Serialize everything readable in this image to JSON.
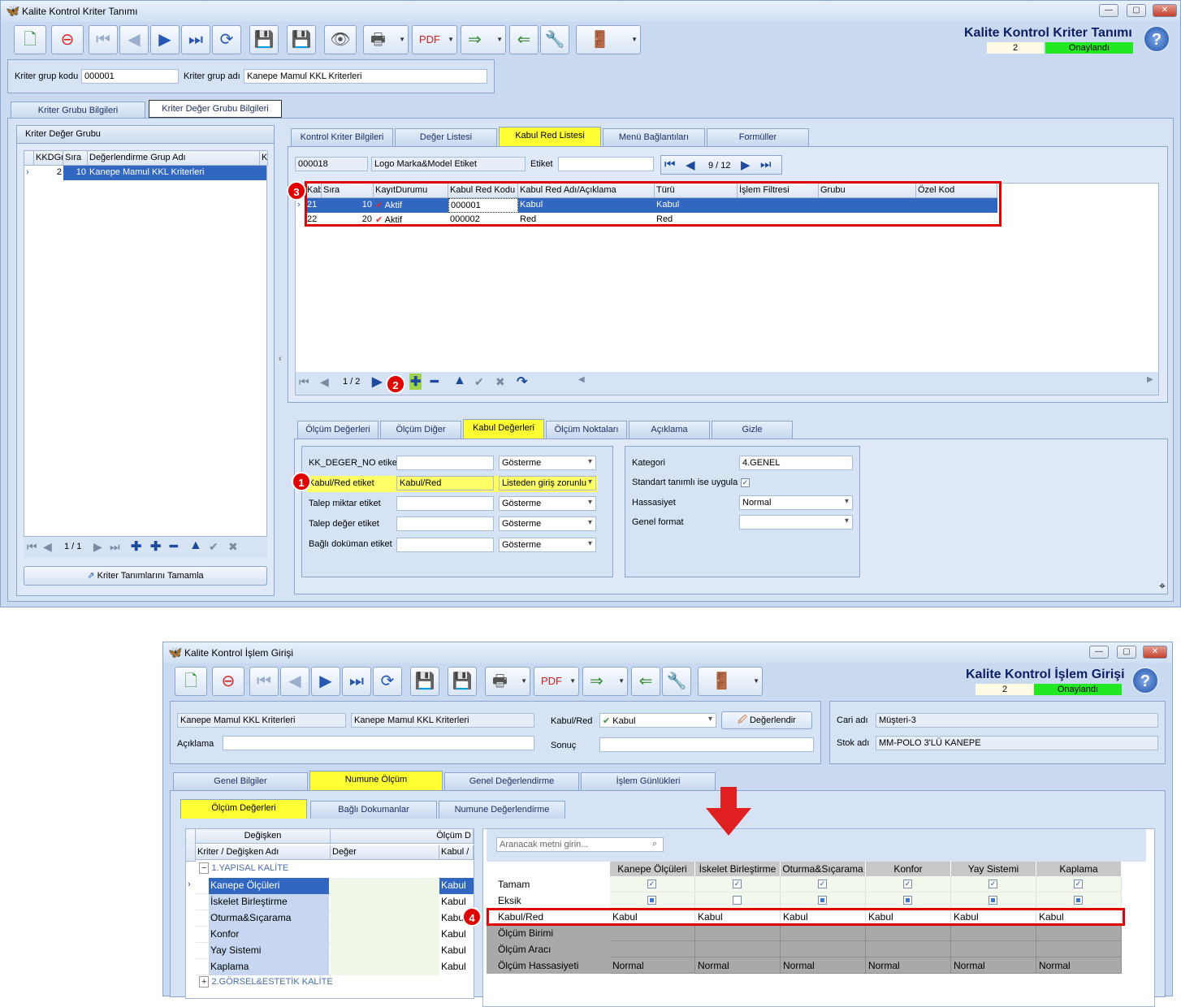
{
  "win1": {
    "title": "Kalite Kontrol Kriter Tanımı",
    "big_title": "Kalite Kontrol Kriter Tanımı",
    "status_num": "2",
    "status_text": "Onaylandı",
    "grp_kod_label": "Kriter grup kodu",
    "grp_kod": "000001",
    "grp_adi_label": "Kriter grup adı",
    "grp_adi": "Kanepe Mamul KKL Kriterleri",
    "tabs": [
      "Kriter Grubu Bilgileri",
      "Kriter Değer Grubu Bilgileri"
    ],
    "left_panel_title": "Kriter Değer Grubu",
    "left_grid_headers": [
      "KKDGr",
      "Sıra",
      "Değerlendirme Grup Adı",
      "K"
    ],
    "left_grid_row": {
      "kk": "2",
      "sira": "10",
      "ad": "Kanepe Mamul KKL Kriterleri"
    },
    "left_nav_pager": "1 / 1",
    "left_button": "Kriter Tanımlarını Tamamla",
    "right_tabs": [
      "Kontrol Kriter Bilgileri",
      "Değer Listesi",
      "Kabul Red Listesi",
      "Menü Bağlantıları",
      "Formüller"
    ],
    "code": "000018",
    "code_name": "Logo Marka&Model Etiket",
    "etiket_label": "Etiket",
    "etiket_value": "",
    "pager": "9 / 12",
    "grid_headers": [
      "Kab",
      "Sıra",
      "KayıtDurumu",
      "Kabul Red Kodu",
      "Kabul Red Adı/Açıklama",
      "Türü",
      "İşlem Filtresi",
      "Grubu",
      "Özel Kod"
    ],
    "grid_rows": [
      {
        "kab": "21",
        "sira": "10",
        "durum": "Aktif",
        "kod": "000001",
        "ad": "Kabul",
        "turu": "Kabul"
      },
      {
        "kab": "22",
        "sira": "20",
        "durum": "Aktif",
        "kod": "000002",
        "ad": "Red",
        "turu": "Red"
      }
    ],
    "grid_pager": "1 / 2",
    "bottom_tabs": [
      "Ölçüm Değerleri",
      "Ölçüm Diğer",
      "Kabul Değerleri",
      "Ölçüm Noktaları",
      "Açıklama",
      "Gizle"
    ],
    "form_rows": [
      {
        "label": "KK_DEGER_NO etiket",
        "value": "",
        "combo": "Gösterme"
      },
      {
        "label": "Kabul/Red etiket",
        "value": "Kabul/Red",
        "combo": "Listeden giriş zorunlu"
      },
      {
        "label": "Talep miktar etiket",
        "value": "",
        "combo": "Gösterme"
      },
      {
        "label": "Talep değer etiket",
        "value": "",
        "combo": "Gösterme"
      },
      {
        "label": "Bağlı doküman etiket",
        "value": "",
        "combo": "Gösterme"
      }
    ],
    "kategori_label": "Kategori",
    "kategori": "4.GENEL",
    "standart_label": "Standart tanımlı ise uygula",
    "hassasiyet_label": "Hassasiyet",
    "hassasiyet": "Normal",
    "genel_format_label": "Genel format",
    "genel_format": "",
    "badges": [
      "1",
      "2",
      "3"
    ]
  },
  "win2": {
    "title": "Kalite Kontrol İşlem Girişi",
    "big_title": "Kalite Kontrol İşlem Girişi",
    "status_num": "2",
    "status_text": "Onaylandı",
    "field1": "Kanepe Mamul KKL Kriterleri",
    "field2": "Kanepe Mamul KKL Kriterleri",
    "kabul_red_label": "Kabul/Red",
    "kabul_red": "Kabul",
    "degerlendir": "Değerlendir",
    "aciklama_label": "Açıklama",
    "sonuc_label": "Sonuç",
    "cari_label": "Cari adı",
    "cari": "Müşteri-3",
    "stok_label": "Stok adı",
    "stok": "MM-POLO 3'LÜ KANEPE",
    "tabs": [
      "Genel Bilgiler",
      "Numune Ölçüm",
      "Genel Değerlendirme",
      "İşlem Günlükleri"
    ],
    "subtabs": [
      "Ölçüm Değerleri",
      "Bağlı Dokumanlar",
      "Numune Değerlendirme"
    ],
    "tree_header_top": [
      "Değişken",
      "Ölçüm D"
    ],
    "tree_header": [
      "Kriter / Değişken Adı",
      "Değer",
      "Kabul /"
    ],
    "tree_group1": "1.YAPISAL KALİTE",
    "tree_rows": [
      {
        "ad": "Kanepe Ölçüleri",
        "kabul": "Kabul"
      },
      {
        "ad": "İskelet Birleştirme",
        "kabul": "Kabul"
      },
      {
        "ad": "Oturma&Sıçarama",
        "kabul": "Kabul"
      },
      {
        "ad": "Konfor",
        "kabul": "Kabul"
      },
      {
        "ad": "Yay Sistemi",
        "kabul": "Kabul"
      },
      {
        "ad": "Kaplama",
        "kabul": "Kabul"
      }
    ],
    "tree_group2": "2.GÖRSEL&ESTETİK KALİTE",
    "search_placeholder": "Aranacak metni girin...",
    "matrix_cols": [
      "Kanepe Ölçüleri",
      "İskelet Birleştirme",
      "Oturma&Sıçarama",
      "Konfor",
      "Yay Sistemi",
      "Kaplama"
    ],
    "matrix_rows": [
      "Tamam",
      "Eksik",
      "Kabul/Red",
      "Ölçüm Birimi",
      "Ölçüm Aracı",
      "Ölçüm Hassasiyeti"
    ],
    "kabul_values": [
      "Kabul",
      "Kabul",
      "Kabul",
      "Kabul",
      "Kabul",
      "Kabul"
    ],
    "hassasiyet_values": [
      "Normal",
      "Normal",
      "Normal",
      "Normal",
      "Normal",
      "Normal"
    ],
    "badge": "4"
  },
  "colors": {
    "accent": "#ffff33",
    "status_green": "#22e822",
    "selection": "#3166c1",
    "highlight_red": "#e00000"
  }
}
